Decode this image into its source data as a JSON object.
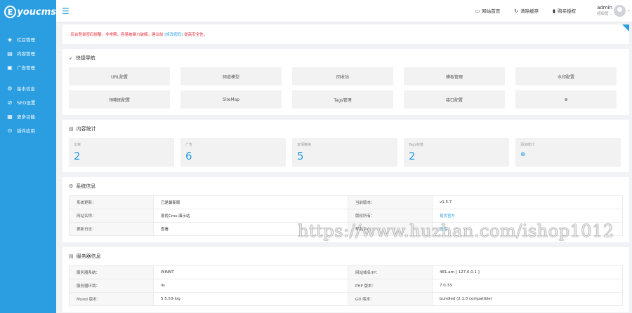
{
  "brand": {
    "logo_letter": "E",
    "logo_text": "youcms"
  },
  "sidebar": {
    "group1": [
      {
        "icon": "layers-icon",
        "glyph": "◈",
        "label": "栏目管理"
      },
      {
        "icon": "document-icon",
        "glyph": "▤",
        "label": "内容管理"
      },
      {
        "icon": "ad-icon",
        "glyph": "▣",
        "label": "广告管理"
      }
    ],
    "group2": [
      {
        "icon": "gear-icon",
        "glyph": "⚙",
        "label": "基本信息"
      },
      {
        "icon": "seo-icon",
        "glyph": "⊘",
        "label": "SEO设置"
      },
      {
        "icon": "grid-icon",
        "glyph": "▦",
        "label": "更多功能"
      },
      {
        "icon": "plugin-icon",
        "glyph": "⊙",
        "label": "插件应用"
      }
    ]
  },
  "header": {
    "links": [
      {
        "icon": "monitor-icon",
        "glyph": "▭",
        "label": "网站首页"
      },
      {
        "icon": "refresh-icon",
        "glyph": "↻",
        "label": "清除缓存"
      },
      {
        "icon": "bookmark-icon",
        "glyph": "▮",
        "label": "购买授权"
      }
    ],
    "user_name": "admin",
    "user_role": "超级管..."
  },
  "notice": {
    "text_before": "· 后台登录密码提醒：非常期，容易被暴力破解，建议前",
    "link": "[修改密码]",
    "text_after": "提高安全性。"
  },
  "quick_nav": {
    "title": "快捷导航",
    "items": [
      "URL配置",
      "频道模型",
      "回收站",
      "模板管理",
      "水印配置",
      "领略图配置",
      "SiteMap",
      "Tags管理",
      "接口配置"
    ]
  },
  "stats": {
    "title": "内容统计",
    "items": [
      {
        "label": "文章",
        "value": "2"
      },
      {
        "label": "广告",
        "value": "6"
      },
      {
        "label": "友情链接",
        "value": "5"
      },
      {
        "label": "Tags标签",
        "value": "2"
      }
    ],
    "add_label": "添加统计"
  },
  "system": {
    "title": "系统信息",
    "rows": [
      {
        "k1": "系统更新：",
        "v1": "已是最新版",
        "k2": "当前版本：",
        "v2": "v1.5.7"
      },
      {
        "k1": "网站名称：",
        "v1": "易优Cms-演示站",
        "k2": "版权所有：",
        "v2": "易优官方"
      },
      {
        "k1": "更新日志：",
        "v1": "查看",
        "k2": "帮助中心：",
        "v2": "查看"
      }
    ]
  },
  "server": {
    "title": "服务器信息",
    "rows": [
      {
        "k1": "服务器系统：",
        "v1": "WINNT",
        "k2": "网站域名/IP：",
        "v2": "481.am [ 127.0.0.1 ]"
      },
      {
        "k1": "服务器环境：",
        "v1": "iis",
        "k2": "PHP 版本：",
        "v2": "7.0.33"
      },
      {
        "k1": "Mysql 版本：",
        "v1": "5.5.53-log",
        "k2": "GD 版本：",
        "v2": "bundled (2.1.0 compatible)"
      }
    ]
  },
  "watermark": "https://www.huzhan.com/ishop1012",
  "colors": {
    "accent": "#2a9ee0",
    "notice": "#e0303b"
  }
}
